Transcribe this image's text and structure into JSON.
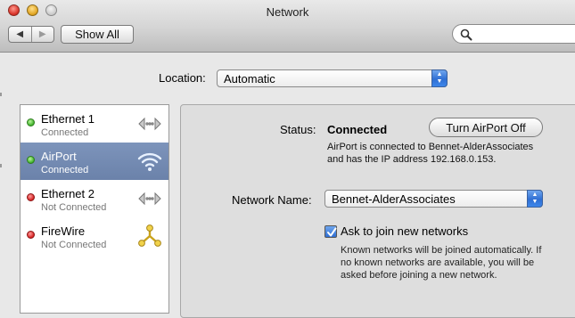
{
  "window": {
    "title": "Network"
  },
  "toolbar": {
    "back_glyph": "◀",
    "forward_glyph": "▶",
    "show_all_label": "Show All",
    "search_placeholder": "",
    "search_icon": "magnifier-icon"
  },
  "location": {
    "label": "Location:",
    "value": "Automatic"
  },
  "services": [
    {
      "name": "Ethernet 1",
      "status": "Connected",
      "indicator": "green",
      "icon": "ethernet-icon",
      "selected": false
    },
    {
      "name": "AirPort",
      "status": "Connected",
      "indicator": "green",
      "icon": "wifi-icon",
      "selected": true
    },
    {
      "name": "Ethernet 2",
      "status": "Not Connected",
      "indicator": "red",
      "icon": "ethernet-icon",
      "selected": false
    },
    {
      "name": "FireWire",
      "status": "Not Connected",
      "indicator": "red",
      "icon": "firewire-icon",
      "selected": false
    }
  ],
  "detail": {
    "status_label": "Status:",
    "status_value": "Connected",
    "turn_off_label": "Turn AirPort Off",
    "status_description": "AirPort is connected to Bennet-AlderAssociates and has the IP address 192.168.0.153.",
    "network_name_label": "Network Name:",
    "network_name_value": "Bennet-AlderAssociates",
    "ask_join_label": "Ask to join new networks",
    "ask_join_checked": true,
    "known_networks_text": "Known networks will be joined automatically. If no known networks are available, you will be asked before joining a new network."
  },
  "colors": {
    "selection": "#6b82aa",
    "indicator_green": "#3fb12a",
    "indicator_red": "#d42020",
    "accent_blue": "#2f6fd3"
  }
}
